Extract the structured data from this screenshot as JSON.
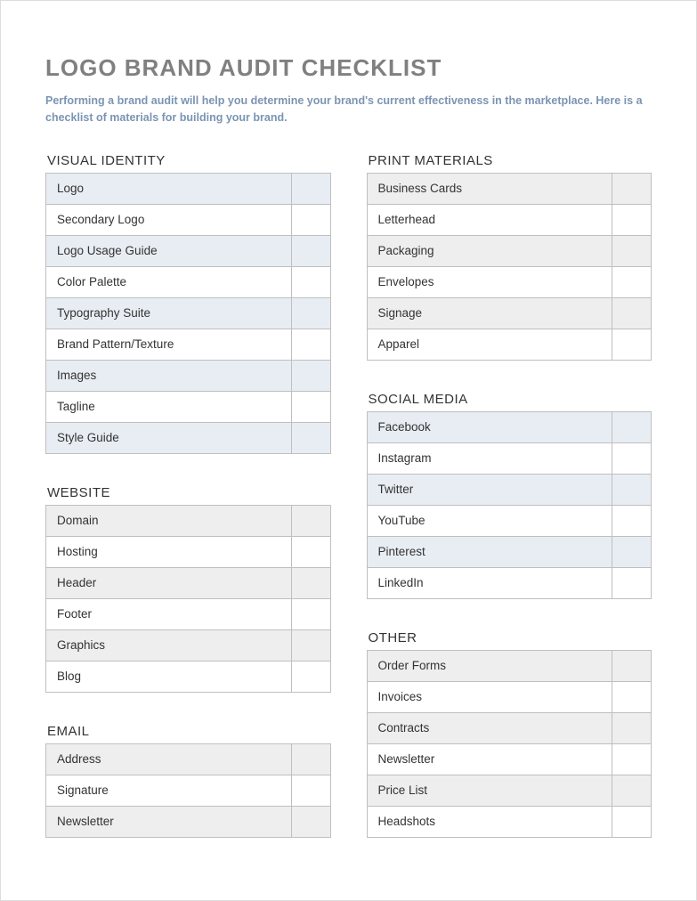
{
  "title": "LOGO BRAND AUDIT CHECKLIST",
  "subtitle": "Performing a brand audit will help you determine your brand's current effectiveness in the marketplace. Here is a checklist of materials for building your brand.",
  "left_sections": [
    {
      "heading": "VISUAL IDENTITY",
      "shade": "blue",
      "items": [
        "Logo",
        "Secondary Logo",
        "Logo Usage Guide",
        "Color Palette",
        "Typography Suite",
        "Brand Pattern/Texture",
        "Images",
        "Tagline",
        "Style Guide"
      ]
    },
    {
      "heading": "WEBSITE",
      "shade": "gray",
      "items": [
        "Domain",
        "Hosting",
        "Header",
        "Footer",
        "Graphics",
        "Blog"
      ]
    },
    {
      "heading": "EMAIL",
      "shade": "gray",
      "items": [
        "Address",
        "Signature",
        "Newsletter"
      ]
    }
  ],
  "right_sections": [
    {
      "heading": "PRINT MATERIALS",
      "shade": "gray",
      "items": [
        "Business Cards",
        "Letterhead",
        "Packaging",
        "Envelopes",
        "Signage",
        "Apparel"
      ]
    },
    {
      "heading": "SOCIAL MEDIA",
      "shade": "blue",
      "items": [
        "Facebook",
        "Instagram",
        "Twitter",
        "YouTube",
        "Pinterest",
        "LinkedIn"
      ]
    },
    {
      "heading": "OTHER",
      "shade": "gray",
      "items": [
        "Order Forms",
        "Invoices",
        "Contracts",
        "Newsletter",
        "Price List",
        "Headshots"
      ]
    }
  ]
}
